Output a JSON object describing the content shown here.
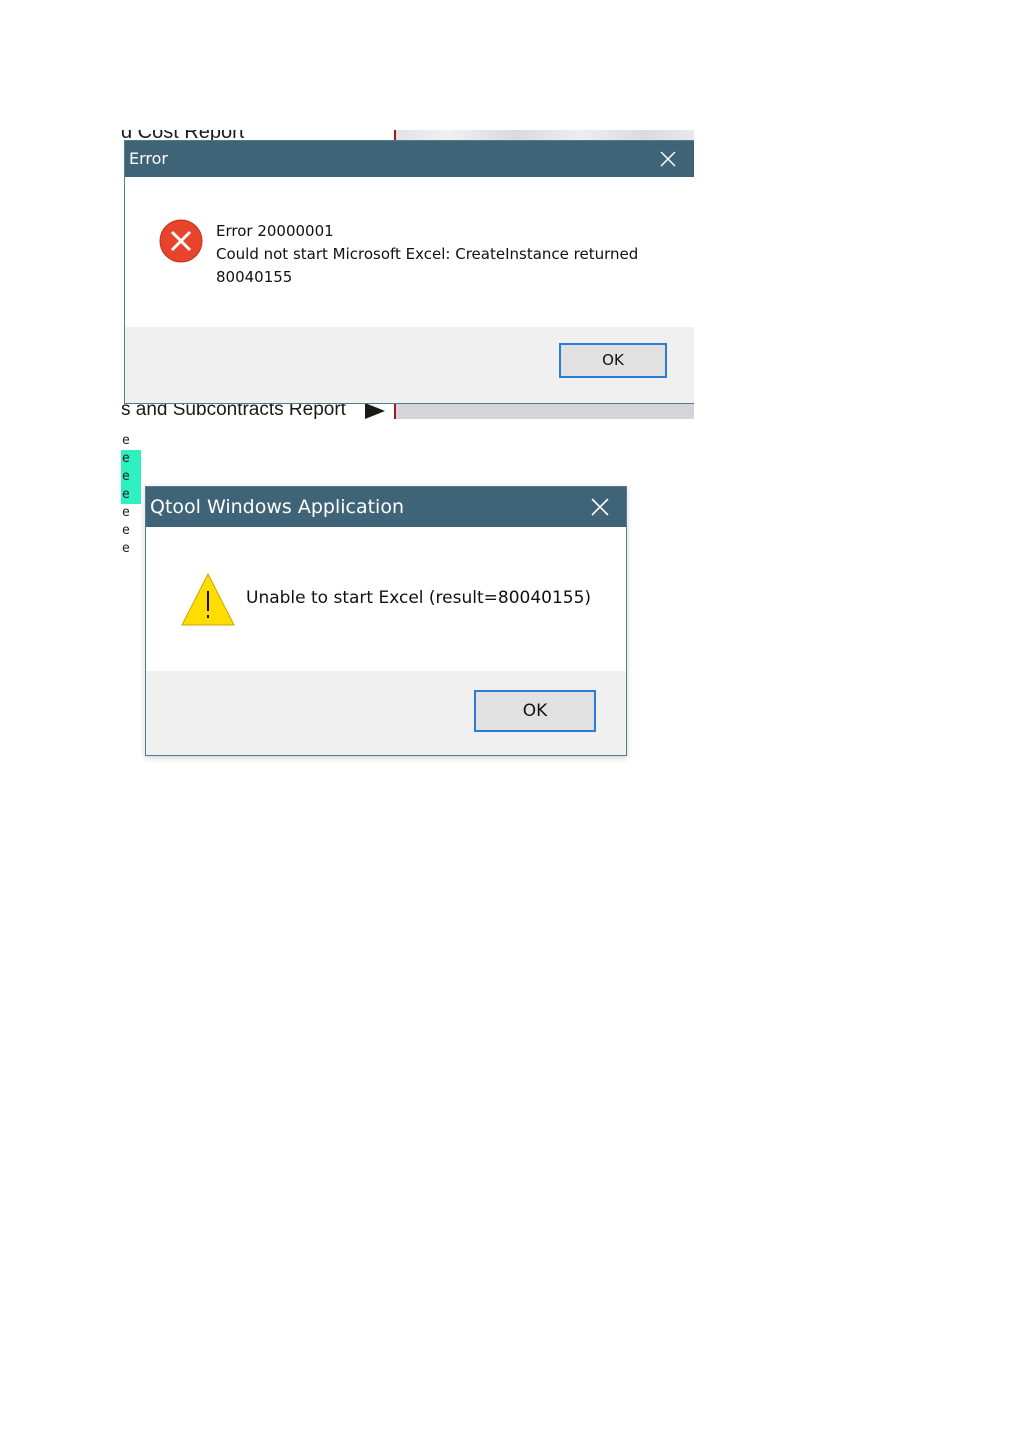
{
  "screenshot1": {
    "background": {
      "top_text": "d Cost Report",
      "bottom_text": "s and Subcontracts Report"
    },
    "error_dialog": {
      "title": "Error",
      "message_lines": [
        "Error 20000001",
        "Could not start Microsoft Excel: CreateInstance returned",
        "80040155"
      ],
      "ok_label": "OK",
      "icon": "error-x-icon",
      "accent": "#3f6478",
      "icon_color": "#e8432c"
    }
  },
  "e_column": [
    "e",
    "e",
    "e",
    "e",
    "e",
    "e",
    "e"
  ],
  "screenshot2": {
    "qtool_dialog": {
      "title": "Qtool Windows Application",
      "message": "Unable to start Excel (result=80040155)",
      "ok_label": "OK",
      "icon": "warning-icon",
      "accent": "#3f6478",
      "icon_color": "#ffdd00"
    }
  }
}
